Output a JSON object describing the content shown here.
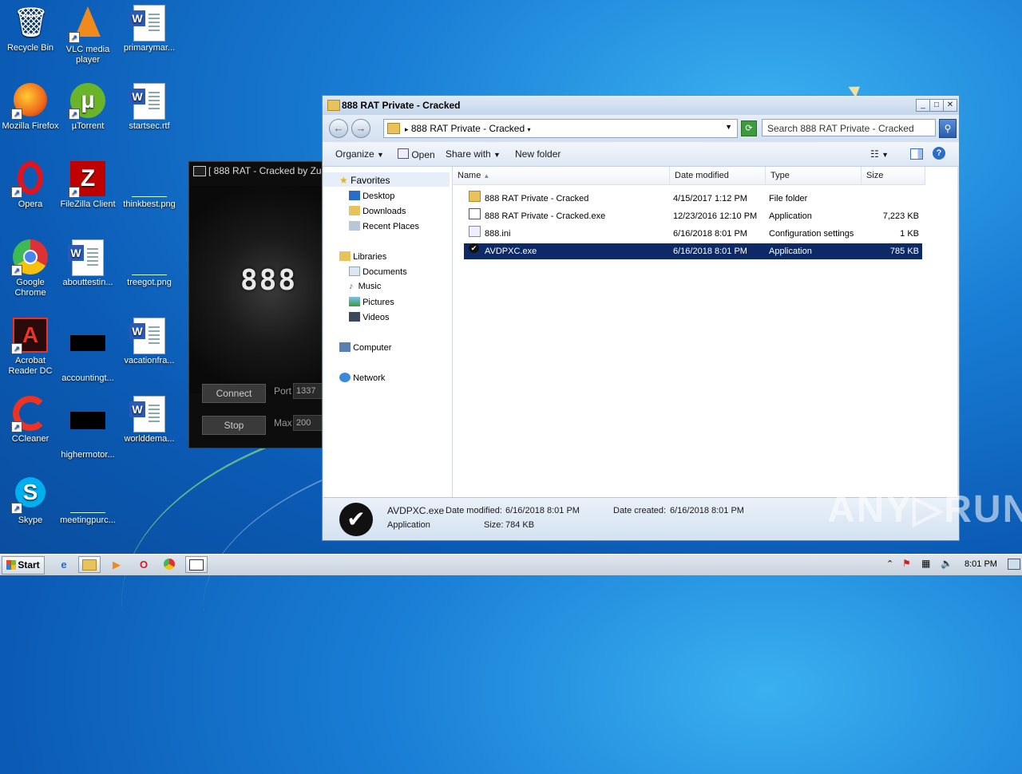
{
  "desktop": {
    "icons": [
      {
        "label": "Recycle Bin",
        "glyph": "🗑",
        "type": "bin"
      },
      {
        "label": "VLC media player",
        "glyph": "▲",
        "type": "vlc"
      },
      {
        "label": "primarymar...",
        "type": "word"
      },
      {
        "label": "Mozilla Firefox",
        "glyph": "🦊",
        "type": "firefox"
      },
      {
        "label": "µTorrent",
        "glyph": "µ",
        "type": "utorrent"
      },
      {
        "label": "startsec.rtf",
        "type": "word"
      },
      {
        "label": "Opera",
        "glyph": "O",
        "type": "opera"
      },
      {
        "label": "FileZilla Client",
        "glyph": "Z",
        "type": "filezilla"
      },
      {
        "label": "thinkbest.png",
        "type": "blank"
      },
      {
        "label": "Google Chrome",
        "glyph": "●",
        "type": "chrome"
      },
      {
        "label": "abouttestin...",
        "type": "word"
      },
      {
        "label": "treegot.png",
        "type": "blank"
      },
      {
        "label": "Acrobat Reader DC",
        "glyph": "A",
        "type": "acrobat"
      },
      {
        "label": "accountingt...",
        "type": "black"
      },
      {
        "label": "vacationfra...",
        "type": "word"
      },
      {
        "label": "CCleaner",
        "glyph": "C",
        "type": "ccleaner"
      },
      {
        "label": "highermotor...",
        "type": "black"
      },
      {
        "label": "worlddema...",
        "type": "word"
      },
      {
        "label": "Skype",
        "glyph": "S",
        "type": "skype"
      },
      {
        "label": "meetingpurc...",
        "type": "blank"
      }
    ]
  },
  "rat_window": {
    "title": "[ 888 RAT - Cracked by Zu",
    "logo": "888",
    "connect_label": "Connect",
    "stop_label": "Stop",
    "port_label": "Port",
    "port_value": "1337",
    "max_label": "Max",
    "max_value": "200"
  },
  "explorer": {
    "title": "888 RAT Private - Cracked",
    "address": "888 RAT Private - Cracked",
    "search_placeholder": "Search 888 RAT Private - Cracked",
    "toolbar": {
      "organize": "Organize",
      "open": "Open",
      "share_with": "Share with",
      "new_folder": "New folder"
    },
    "nav": {
      "favorites": "Favorites",
      "desktop": "Desktop",
      "downloads": "Downloads",
      "recent_places": "Recent Places",
      "libraries": "Libraries",
      "documents": "Documents",
      "music": "Music",
      "pictures": "Pictures",
      "videos": "Videos",
      "computer": "Computer",
      "network": "Network"
    },
    "columns": {
      "name": "Name",
      "date_modified": "Date modified",
      "type": "Type",
      "size": "Size"
    },
    "files": [
      {
        "name": "888 RAT Private - Cracked",
        "date": "4/15/2017 1:12 PM",
        "type": "File folder",
        "size": "",
        "icon": "folder"
      },
      {
        "name": "888 RAT Private - Cracked.exe",
        "date": "12/23/2016 12:10 PM",
        "type": "Application",
        "size": "7,223 KB",
        "icon": "exe"
      },
      {
        "name": "888.ini",
        "date": "6/16/2018 8:01 PM",
        "type": "Configuration settings",
        "size": "1 KB",
        "icon": "ini"
      },
      {
        "name": "AVDPXC.exe",
        "date": "6/16/2018 8:01 PM",
        "type": "Application",
        "size": "785 KB",
        "icon": "check",
        "selected": true
      }
    ],
    "details": {
      "filename": "AVDPXC.exe",
      "modified_label": "Date modified:",
      "modified_value": "6/16/2018 8:01 PM",
      "created_label": "Date created:",
      "created_value": "6/16/2018 8:01 PM",
      "type": "Application",
      "size_label": "Size:",
      "size_value": "784 KB"
    }
  },
  "watermark": "ANY▷RUN",
  "taskbar": {
    "start_label": "Start",
    "clock": "8:01 PM"
  }
}
